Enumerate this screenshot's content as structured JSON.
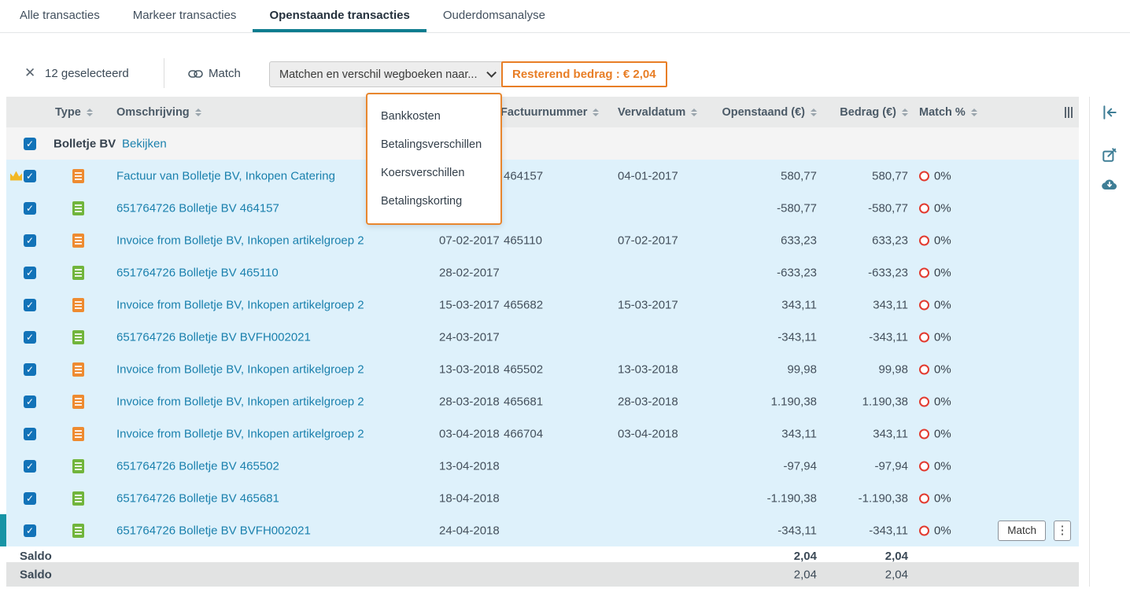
{
  "tabs": [
    {
      "label": "Alle transacties",
      "active": false
    },
    {
      "label": "Markeer transacties",
      "active": false
    },
    {
      "label": "Openstaande transacties",
      "active": true
    },
    {
      "label": "Ouderdomsanalyse",
      "active": false
    }
  ],
  "toolbar": {
    "selected_count": "12 geselecteerd",
    "match_label": "Match",
    "dropdown_value": "Matchen en verschil wegboeken naar...",
    "remaining_label": "Resterend bedrag : € 2,04"
  },
  "menu": {
    "items": [
      "Bankkosten",
      "Betalingsverschillen",
      "Koersverschillen",
      "Betalingskorting"
    ]
  },
  "table": {
    "headers": {
      "type": "Type",
      "omschrijving": "Omschrijving",
      "factuurnummer": "Factuurnummer",
      "vervaldatum": "Vervaldatum",
      "openstaand": "Openstaand (€)",
      "bedrag": "Bedrag (€)",
      "match": "Match %"
    },
    "group": {
      "name": "Bolletje BV",
      "link": "Bekijken"
    },
    "rows": [
      {
        "type": "invoice",
        "crown": true,
        "desc": "Factuur van Bolletje BV, Inkopen Catering",
        "datum": "",
        "factuurnummer": "464157",
        "vervaldatum": "04-01-2017",
        "openstaand": "580,77",
        "bedrag": "580,77",
        "match": "0%"
      },
      {
        "type": "bank",
        "desc": "651764726 Bolletje BV 464157",
        "datum": "",
        "factuurnummer": "",
        "vervaldatum": "",
        "openstaand": "-580,77",
        "bedrag": "-580,77",
        "match": "0%"
      },
      {
        "type": "invoice",
        "desc": "Invoice from Bolletje BV, Inkopen artikelgroep 2",
        "datum": "07-02-2017",
        "factuurnummer": "465110",
        "vervaldatum": "07-02-2017",
        "openstaand": "633,23",
        "bedrag": "633,23",
        "match": "0%"
      },
      {
        "type": "bank",
        "desc": "651764726 Bolletje BV 465110",
        "datum": "28-02-2017",
        "factuurnummer": "",
        "vervaldatum": "",
        "openstaand": "-633,23",
        "bedrag": "-633,23",
        "match": "0%"
      },
      {
        "type": "invoice",
        "desc": "Invoice from Bolletje BV, Inkopen artikelgroep 2",
        "datum": "15-03-2017",
        "factuurnummer": "465682",
        "vervaldatum": "15-03-2017",
        "openstaand": "343,11",
        "bedrag": "343,11",
        "match": "0%"
      },
      {
        "type": "bank",
        "desc": "651764726 Bolletje BV BVFH002021",
        "datum": "24-03-2017",
        "factuurnummer": "",
        "vervaldatum": "",
        "openstaand": "-343,11",
        "bedrag": "-343,11",
        "match": "0%"
      },
      {
        "type": "invoice",
        "desc": "Invoice from Bolletje BV, Inkopen artikelgroep 2",
        "datum": "13-03-2018",
        "factuurnummer": "465502",
        "vervaldatum": "13-03-2018",
        "openstaand": "99,98",
        "bedrag": "99,98",
        "match": "0%"
      },
      {
        "type": "invoice",
        "desc": "Invoice from Bolletje BV, Inkopen artikelgroep 2",
        "datum": "28-03-2018",
        "factuurnummer": "465681",
        "vervaldatum": "28-03-2018",
        "openstaand": "1.190,38",
        "bedrag": "1.190,38",
        "match": "0%"
      },
      {
        "type": "invoice",
        "desc": "Invoice from Bolletje BV, Inkopen artikelgroep 2",
        "datum": "03-04-2018",
        "factuurnummer": "466704",
        "vervaldatum": "03-04-2018",
        "openstaand": "343,11",
        "bedrag": "343,11",
        "match": "0%"
      },
      {
        "type": "bank",
        "desc": "651764726 Bolletje BV 465502",
        "datum": "13-04-2018",
        "factuurnummer": "",
        "vervaldatum": "",
        "openstaand": "-97,94",
        "bedrag": "-97,94",
        "match": "0%"
      },
      {
        "type": "bank",
        "desc": "651764726 Bolletje BV 465681",
        "datum": "18-04-2018",
        "factuurnummer": "",
        "vervaldatum": "",
        "openstaand": "-1.190,38",
        "bedrag": "-1.190,38",
        "match": "0%"
      },
      {
        "type": "bank",
        "desc": "651764726 Bolletje BV BVFH002021",
        "datum": "24-04-2018",
        "factuurnummer": "",
        "vervaldatum": "",
        "openstaand": "-343,11",
        "bedrag": "-343,11",
        "match": "0%",
        "active": true,
        "has_actions": true
      }
    ],
    "subtotal": {
      "label": "Saldo",
      "openstaand": "2,04",
      "bedrag": "2,04"
    },
    "footer": {
      "label": "Saldo",
      "openstaand": "2,04",
      "bedrag": "2,04"
    }
  },
  "row_actions": {
    "match": "Match",
    "kebab": "⋮"
  },
  "colors": {
    "accent_teal": "#0e7d8f",
    "link_blue": "#1a80ad",
    "orange": "#e87e26",
    "row_selected": "#def1fb",
    "checkbox_blue": "#1273b8",
    "error_red": "#e23b30"
  }
}
